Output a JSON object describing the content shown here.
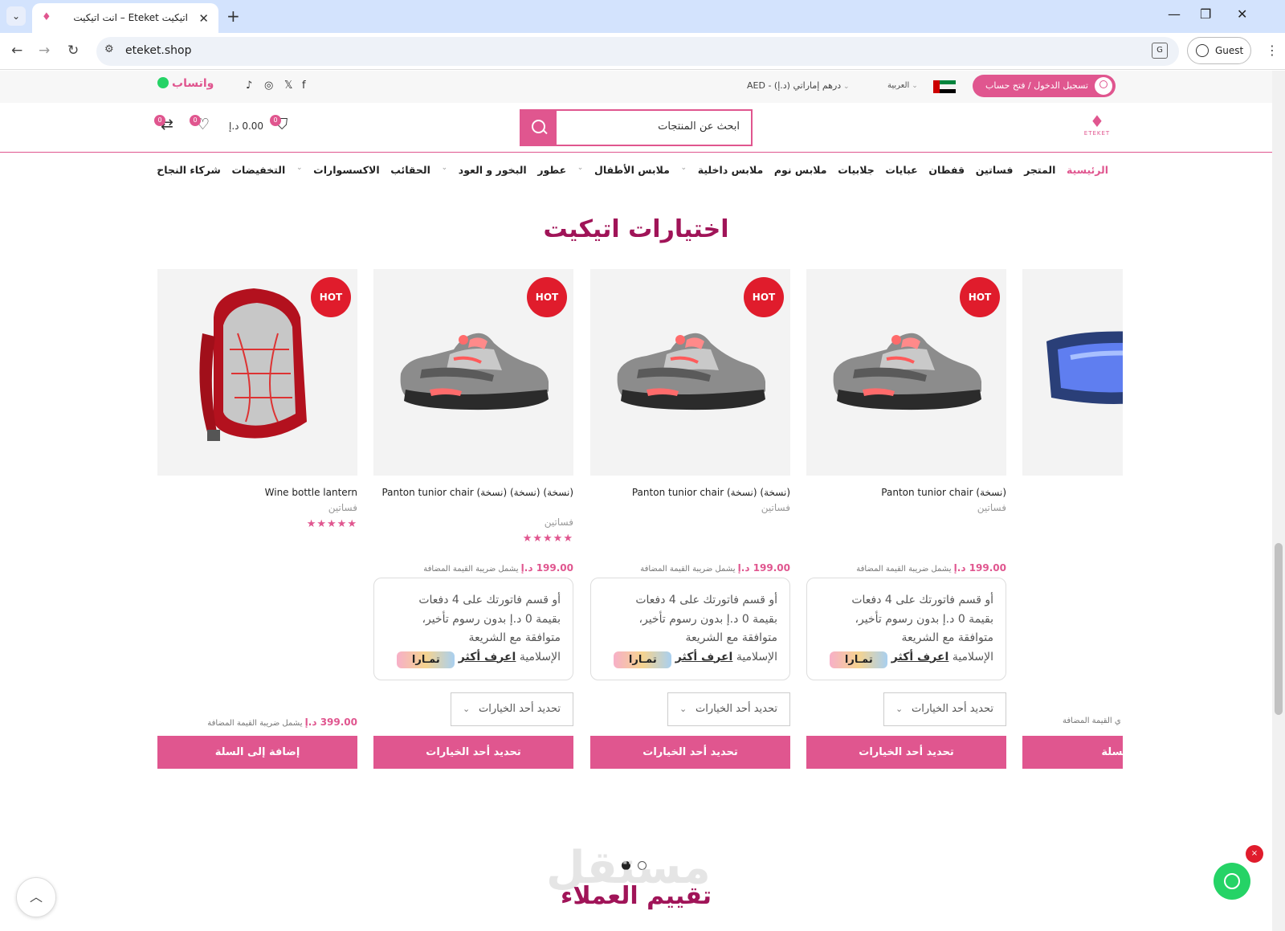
{
  "browser": {
    "tab_title": "اتيكيت Eteket – انت اتيكيت",
    "url": "eteket.shop",
    "profile_label": "Guest",
    "new_tab": "+",
    "close": "✕"
  },
  "topbar": {
    "login_label": "تسجيل الدخول / فتح حساب",
    "language": "العربية",
    "currency": "درهم إماراتي (د.إ) - AED",
    "whatsapp_label": "واتساب",
    "flag_colors": [
      "#c00000",
      "#00843d",
      "#ffffff",
      "#000000"
    ]
  },
  "header": {
    "logo_text": "ETEKET",
    "search_placeholder": "ابحث عن المنتجات",
    "cart_total": "0.00 د.إ",
    "cart_count": "0",
    "wishlist_count": "0",
    "compare_count": "0"
  },
  "nav": [
    {
      "label": "الرئيسية",
      "active": true
    },
    {
      "label": "المتجر"
    },
    {
      "label": "فساتين"
    },
    {
      "label": "قفطان"
    },
    {
      "label": "عبايات"
    },
    {
      "label": "جلابيات"
    },
    {
      "label": "ملابس نوم"
    },
    {
      "label": "ملابس داخلية",
      "dropdown": true
    },
    {
      "label": "ملابس الأطفال",
      "dropdown": true
    },
    {
      "label": "عطور"
    },
    {
      "label": "البخور و العود",
      "dropdown": true
    },
    {
      "label": "الحقائب"
    },
    {
      "label": "الاكسسوارات",
      "dropdown": true
    },
    {
      "label": "التخفيضات"
    },
    {
      "label": "شركاء النجاح"
    }
  ],
  "section_title": "اختيارات اتيكيت",
  "products": [
    {
      "name": "Panton tunior chair (نسخة)",
      "category": "فساتين",
      "badge": "HOT",
      "price": "199.00 د.إ",
      "tax_note": "يشمل ضريبة القيمة المضافة",
      "tamara_l1": "أو قسم فاتورتك على 4 دفعات",
      "tamara_l2": "بقيمة 0 د.إ بدون رسوم تأخير،",
      "tamara_l3": "متوافقة مع الشريعة",
      "tamara_l4": "الإسلامية",
      "tamara_learn": "اعرف أكثر",
      "tamara_logo": "تمـارا",
      "select_label": "تحديد أحد الخيارات",
      "button": "تحديد أحد الخيارات"
    },
    {
      "name": "Panton tunior chair (نسخة) (نسخة)",
      "category": "فساتين",
      "badge": "HOT",
      "price": "199.00 د.إ",
      "tax_note": "يشمل ضريبة القيمة المضافة",
      "tamara_l1": "أو قسم فاتورتك على 4 دفعات",
      "tamara_l2": "بقيمة 0 د.إ بدون رسوم تأخير،",
      "tamara_l3": "متوافقة مع الشريعة",
      "tamara_l4": "الإسلامية",
      "tamara_learn": "اعرف أكثر",
      "tamara_logo": "تمـارا",
      "select_label": "تحديد أحد الخيارات",
      "button": "تحديد أحد الخيارات"
    },
    {
      "name": "Panton tunior chair (نسخة) (نسخة) (نسخة)",
      "category": "فساتين",
      "badge": "HOT",
      "stars": "★★★★★",
      "rating": 5,
      "price": "199.00 د.إ",
      "tax_note": "يشمل ضريبة القيمة المضافة",
      "tamara_l1": "أو قسم فاتورتك على 4 دفعات",
      "tamara_l2": "بقيمة 0 د.إ بدون رسوم تأخير،",
      "tamara_l3": "متوافقة مع الشريعة",
      "tamara_l4": "الإسلامية",
      "tamara_learn": "اعرف أكثر",
      "tamara_logo": "تمـارا",
      "select_label": "تحديد أحد الخيارات",
      "button": "تحديد أحد الخيارات"
    },
    {
      "name": "Wine bottle lantern",
      "category": "فساتين",
      "badge": "HOT",
      "stars": "★★★★★",
      "rating": 5,
      "price": "399.00 د.إ",
      "tax_note": "يشمل ضريبة القيمة المضافة",
      "button": "إضافة إلى السلة"
    },
    {
      "partial_tax_note": "ي القيمة المضافة",
      "button": "ى السلة"
    }
  ],
  "carousel": {
    "pages": 2,
    "active": 1
  },
  "reviews_title": "تقييم العملاء",
  "watermark": "مستقل",
  "back_to_top": "︿",
  "whatsapp_close": "×"
}
